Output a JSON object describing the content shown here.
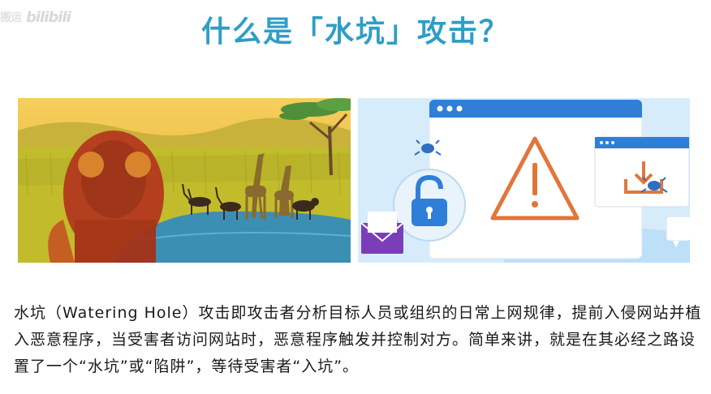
{
  "watermark": {
    "prefix": "搬运",
    "brand": "bilibili"
  },
  "slide": {
    "title": "什么是「水坑」攻击？",
    "description": "水坑（Watering Hole）攻击即攻击者分析目标人员或组织的日常上网规律，提前入侵网站并植入恶意程序，当受害者访问网站时，恶意程序触发并控制对方。简单来讲，就是在其必经之路设置了一个“水坑”或“陷阱”，等待受害者“入坑”。"
  },
  "illustrations": {
    "left": {
      "subject": "savanna-watering-hole-with-lion",
      "colors": {
        "sky": "#f3c24a",
        "grass": "#c7c22a",
        "water": "#3b8fb3",
        "lion": "#b4391e"
      }
    },
    "right": {
      "subject": "browser-warning-malware",
      "colors": {
        "accent": "#2f7fd8",
        "warning": "#e2763a",
        "envelope": "#7a3fb8"
      }
    }
  }
}
